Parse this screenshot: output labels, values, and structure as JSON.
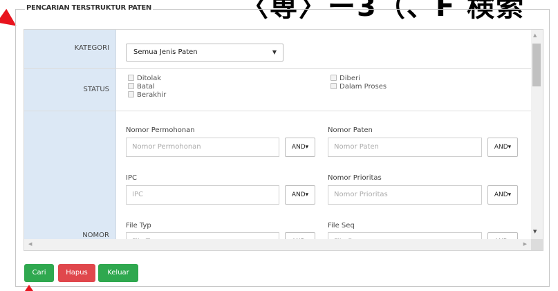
{
  "overlay": {
    "title": "〈専〉ー3（、F 検索"
  },
  "legend": "PENCARIAN TERSTRUKTUR PATEN",
  "kategori": {
    "label": "KATEGORI",
    "selected": "Semua Jenis Paten"
  },
  "status": {
    "label": "STATUS",
    "options": [
      "Ditolak",
      "Batal",
      "Berakhir",
      "Diberi",
      "Dalam Proses"
    ]
  },
  "nomor": {
    "label": "NOMOR",
    "operator": "AND▾",
    "fields": [
      {
        "label": "Nomor Permohonan",
        "placeholder": "Nomor Permohonan"
      },
      {
        "label": "Nomor Paten",
        "placeholder": "Nomor Paten"
      },
      {
        "label": "IPC",
        "placeholder": "IPC"
      },
      {
        "label": "Nomor Prioritas",
        "placeholder": "Nomor Prioritas"
      },
      {
        "label": "File Typ",
        "placeholder": "File Typ"
      },
      {
        "label": "File Seq",
        "placeholder": "File Seq"
      }
    ]
  },
  "buttons": {
    "cari": "Cari",
    "hapus": "Hapus",
    "keluar": "Keluar"
  },
  "colors": {
    "label_bg": "#dce8f5",
    "green": "#2fa84f",
    "red": "#e0474c",
    "arrow": "#e8141e"
  },
  "icons": [
    "caret-down-icon",
    "checkbox-icon",
    "scroll-up-icon",
    "scroll-down-icon",
    "scroll-left-icon",
    "scroll-right-icon",
    "arrow-annotation"
  ]
}
